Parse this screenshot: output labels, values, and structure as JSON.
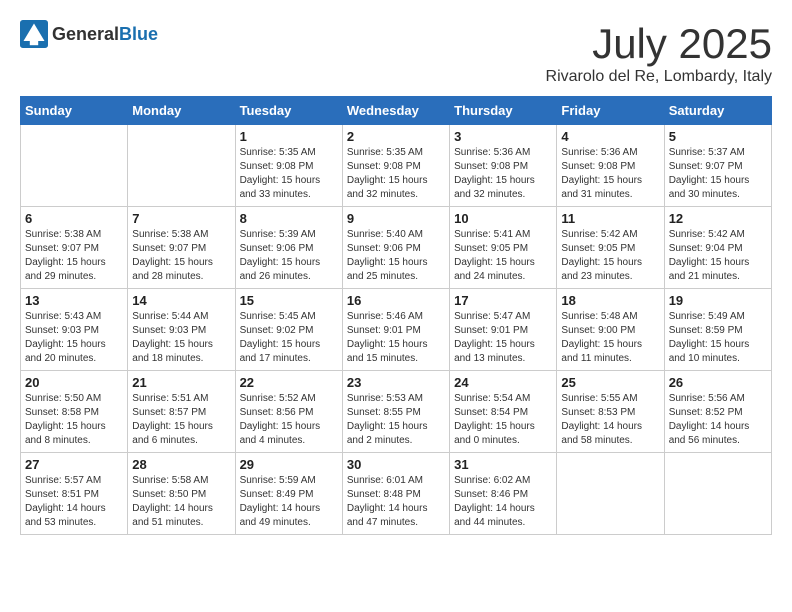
{
  "header": {
    "logo_general": "General",
    "logo_blue": "Blue",
    "month_year": "July 2025",
    "location": "Rivarolo del Re, Lombardy, Italy"
  },
  "weekdays": [
    "Sunday",
    "Monday",
    "Tuesday",
    "Wednesday",
    "Thursday",
    "Friday",
    "Saturday"
  ],
  "weeks": [
    [
      {
        "day": "",
        "info": ""
      },
      {
        "day": "",
        "info": ""
      },
      {
        "day": "1",
        "info": "Sunrise: 5:35 AM\nSunset: 9:08 PM\nDaylight: 15 hours\nand 33 minutes."
      },
      {
        "day": "2",
        "info": "Sunrise: 5:35 AM\nSunset: 9:08 PM\nDaylight: 15 hours\nand 32 minutes."
      },
      {
        "day": "3",
        "info": "Sunrise: 5:36 AM\nSunset: 9:08 PM\nDaylight: 15 hours\nand 32 minutes."
      },
      {
        "day": "4",
        "info": "Sunrise: 5:36 AM\nSunset: 9:08 PM\nDaylight: 15 hours\nand 31 minutes."
      },
      {
        "day": "5",
        "info": "Sunrise: 5:37 AM\nSunset: 9:07 PM\nDaylight: 15 hours\nand 30 minutes."
      }
    ],
    [
      {
        "day": "6",
        "info": "Sunrise: 5:38 AM\nSunset: 9:07 PM\nDaylight: 15 hours\nand 29 minutes."
      },
      {
        "day": "7",
        "info": "Sunrise: 5:38 AM\nSunset: 9:07 PM\nDaylight: 15 hours\nand 28 minutes."
      },
      {
        "day": "8",
        "info": "Sunrise: 5:39 AM\nSunset: 9:06 PM\nDaylight: 15 hours\nand 26 minutes."
      },
      {
        "day": "9",
        "info": "Sunrise: 5:40 AM\nSunset: 9:06 PM\nDaylight: 15 hours\nand 25 minutes."
      },
      {
        "day": "10",
        "info": "Sunrise: 5:41 AM\nSunset: 9:05 PM\nDaylight: 15 hours\nand 24 minutes."
      },
      {
        "day": "11",
        "info": "Sunrise: 5:42 AM\nSunset: 9:05 PM\nDaylight: 15 hours\nand 23 minutes."
      },
      {
        "day": "12",
        "info": "Sunrise: 5:42 AM\nSunset: 9:04 PM\nDaylight: 15 hours\nand 21 minutes."
      }
    ],
    [
      {
        "day": "13",
        "info": "Sunrise: 5:43 AM\nSunset: 9:03 PM\nDaylight: 15 hours\nand 20 minutes."
      },
      {
        "day": "14",
        "info": "Sunrise: 5:44 AM\nSunset: 9:03 PM\nDaylight: 15 hours\nand 18 minutes."
      },
      {
        "day": "15",
        "info": "Sunrise: 5:45 AM\nSunset: 9:02 PM\nDaylight: 15 hours\nand 17 minutes."
      },
      {
        "day": "16",
        "info": "Sunrise: 5:46 AM\nSunset: 9:01 PM\nDaylight: 15 hours\nand 15 minutes."
      },
      {
        "day": "17",
        "info": "Sunrise: 5:47 AM\nSunset: 9:01 PM\nDaylight: 15 hours\nand 13 minutes."
      },
      {
        "day": "18",
        "info": "Sunrise: 5:48 AM\nSunset: 9:00 PM\nDaylight: 15 hours\nand 11 minutes."
      },
      {
        "day": "19",
        "info": "Sunrise: 5:49 AM\nSunset: 8:59 PM\nDaylight: 15 hours\nand 10 minutes."
      }
    ],
    [
      {
        "day": "20",
        "info": "Sunrise: 5:50 AM\nSunset: 8:58 PM\nDaylight: 15 hours\nand 8 minutes."
      },
      {
        "day": "21",
        "info": "Sunrise: 5:51 AM\nSunset: 8:57 PM\nDaylight: 15 hours\nand 6 minutes."
      },
      {
        "day": "22",
        "info": "Sunrise: 5:52 AM\nSunset: 8:56 PM\nDaylight: 15 hours\nand 4 minutes."
      },
      {
        "day": "23",
        "info": "Sunrise: 5:53 AM\nSunset: 8:55 PM\nDaylight: 15 hours\nand 2 minutes."
      },
      {
        "day": "24",
        "info": "Sunrise: 5:54 AM\nSunset: 8:54 PM\nDaylight: 15 hours\nand 0 minutes."
      },
      {
        "day": "25",
        "info": "Sunrise: 5:55 AM\nSunset: 8:53 PM\nDaylight: 14 hours\nand 58 minutes."
      },
      {
        "day": "26",
        "info": "Sunrise: 5:56 AM\nSunset: 8:52 PM\nDaylight: 14 hours\nand 56 minutes."
      }
    ],
    [
      {
        "day": "27",
        "info": "Sunrise: 5:57 AM\nSunset: 8:51 PM\nDaylight: 14 hours\nand 53 minutes."
      },
      {
        "day": "28",
        "info": "Sunrise: 5:58 AM\nSunset: 8:50 PM\nDaylight: 14 hours\nand 51 minutes."
      },
      {
        "day": "29",
        "info": "Sunrise: 5:59 AM\nSunset: 8:49 PM\nDaylight: 14 hours\nand 49 minutes."
      },
      {
        "day": "30",
        "info": "Sunrise: 6:01 AM\nSunset: 8:48 PM\nDaylight: 14 hours\nand 47 minutes."
      },
      {
        "day": "31",
        "info": "Sunrise: 6:02 AM\nSunset: 8:46 PM\nDaylight: 14 hours\nand 44 minutes."
      },
      {
        "day": "",
        "info": ""
      },
      {
        "day": "",
        "info": ""
      }
    ]
  ]
}
